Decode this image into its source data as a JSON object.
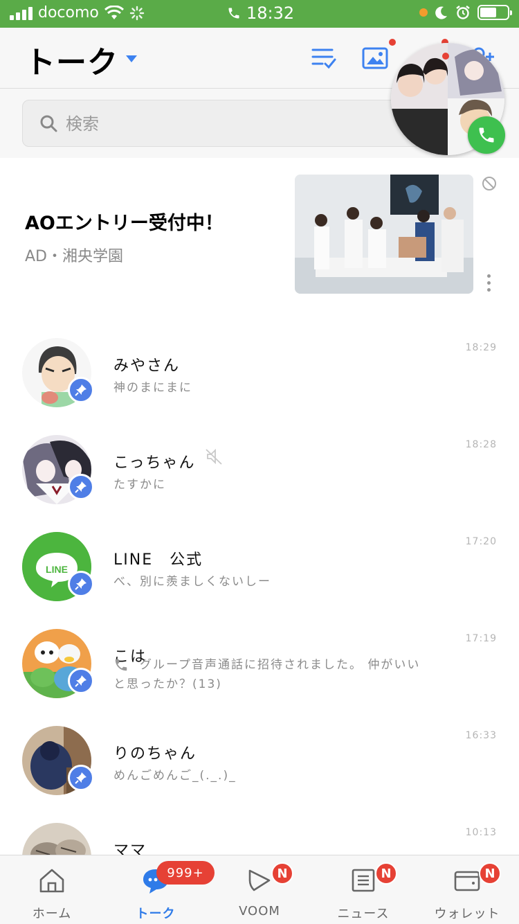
{
  "status_bar": {
    "carrier": "docomo",
    "time": "18:32"
  },
  "header": {
    "title": "トーク"
  },
  "search": {
    "placeholder": "検索"
  },
  "ad": {
    "title": "AOエントリー受付中！",
    "sponsor": "AD・湘央学園"
  },
  "chats": [
    {
      "name": "みやさん",
      "preview": "神のまにまに",
      "time": "18:29",
      "pinned": true,
      "muted": false
    },
    {
      "name": "こっちゃん",
      "preview": "たすかに",
      "time": "18:28",
      "pinned": true,
      "muted": true
    },
    {
      "name": "LINE　公式",
      "preview": "べ、別に羨ましくないしー",
      "time": "17:20",
      "pinned": true,
      "muted": false
    },
    {
      "name": "こは",
      "preview": "グループ音声通話に招待されました。 仲がいいと思ったか？(13)",
      "time": "17:19",
      "pinned": true,
      "muted": false
    },
    {
      "name": "りのちゃん",
      "preview": "めんごめんご_(._.)_",
      "time": "16:33",
      "pinned": true,
      "muted": false
    },
    {
      "name": "ママ",
      "preview": "",
      "time": "10:13",
      "pinned": false,
      "muted": false
    }
  ],
  "tabs": [
    {
      "label": "ホーム",
      "badge": ""
    },
    {
      "label": "トーク",
      "badge": "999+"
    },
    {
      "label": "VOOM",
      "badge": "N"
    },
    {
      "label": "ニュース",
      "badge": "N"
    },
    {
      "label": "ウォレット",
      "badge": "N"
    }
  ],
  "colors": {
    "status_bar": "#5aab48",
    "accent": "#2f7be8",
    "badge": "#e64135",
    "pin": "#4f7ee6",
    "line_green": "#4cb53e"
  }
}
